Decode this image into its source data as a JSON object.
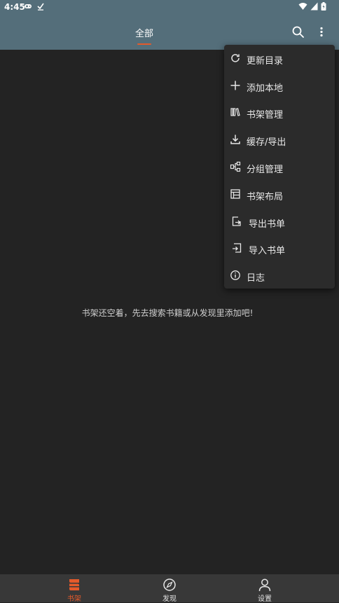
{
  "status_bar": {
    "time": "4:45"
  },
  "app_bar": {
    "tab_label": "全部"
  },
  "main": {
    "empty_message": "书架还空着，先去搜索书籍或从发现里添加吧!"
  },
  "menu": {
    "items": [
      {
        "label": "更新目录",
        "icon": "refresh-icon"
      },
      {
        "label": "添加本地",
        "icon": "plus-icon"
      },
      {
        "label": "书架管理",
        "icon": "bookshelf-icon"
      },
      {
        "label": "缓存/导出",
        "icon": "download-icon"
      },
      {
        "label": "分组管理",
        "icon": "group-icon"
      },
      {
        "label": "书架布局",
        "icon": "layout-icon"
      },
      {
        "label": "导出书单",
        "icon": "export-icon"
      },
      {
        "label": "导入书单",
        "icon": "import-icon"
      },
      {
        "label": "日志",
        "icon": "info-icon"
      }
    ]
  },
  "bottom_nav": {
    "items": [
      {
        "label": "书架",
        "icon": "bookshelf-icon",
        "active": true
      },
      {
        "label": "发现",
        "icon": "compass-icon",
        "active": false
      },
      {
        "label": "设置",
        "icon": "person-icon",
        "active": false
      }
    ]
  },
  "colors": {
    "toolbar": "#546e7a",
    "background": "#232323",
    "menu": "#2b2b2b",
    "accent": "#e45a2b",
    "bottom_nav": "#383838"
  }
}
